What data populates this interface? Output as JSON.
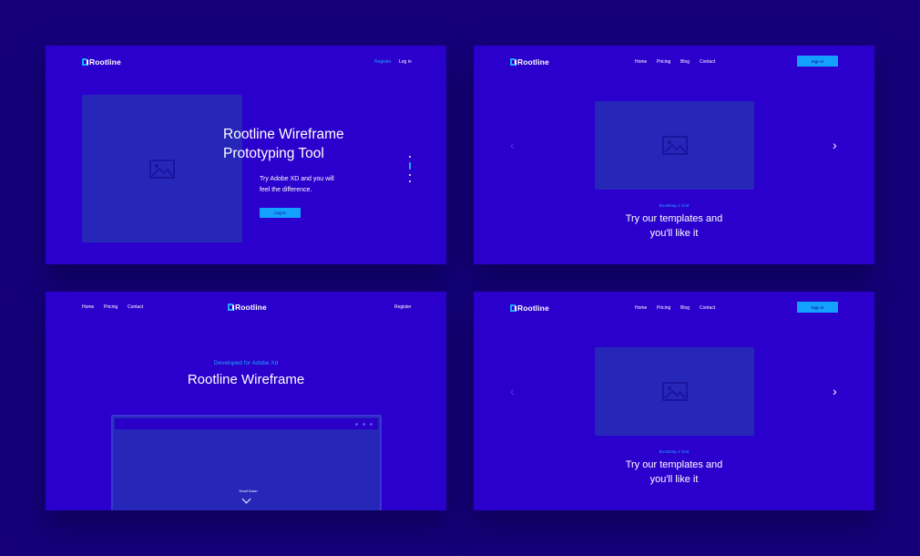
{
  "colors": {
    "background": "#15007a",
    "panel": "#2b00cc",
    "accent": "#1fa8ff",
    "image_placeholder": "#2627b8"
  },
  "brand": "Rootline",
  "panel1": {
    "nav": {
      "register": "Register",
      "login": "Log in"
    },
    "hero_title_line1": "Rootline Wireframe",
    "hero_title_line2": "Prototyping Tool",
    "hero_sub_line1": "Try Adobe XD and you will",
    "hero_sub_line2": "feel the difference.",
    "button": "Log in",
    "image_icon": "image-icon"
  },
  "panel2": {
    "nav": [
      "Home",
      "Pricing",
      "Blog",
      "Contact"
    ],
    "button": "Sign in",
    "eyebrow": "Bootstrap 4 Grid",
    "title_line1": "Try our templates and",
    "title_line2": "you'll like it",
    "prev_icon": "chevron-left-icon",
    "next_icon": "chevron-right-icon"
  },
  "panel3": {
    "nav": [
      "Home",
      "Pricing",
      "Contact"
    ],
    "register": "Register",
    "eyebrow": "Developed for Adobe Xd",
    "title": "Rootline Wireframe",
    "scroll_label": "Scroll Down"
  },
  "panel4": {
    "nav": [
      "Home",
      "Pricing",
      "Blog",
      "Contact"
    ],
    "button": "Sign in",
    "eyebrow": "Bootstrap 4 Grid",
    "title_line1": "Try our templates and",
    "title_line2": "you'll like it"
  }
}
